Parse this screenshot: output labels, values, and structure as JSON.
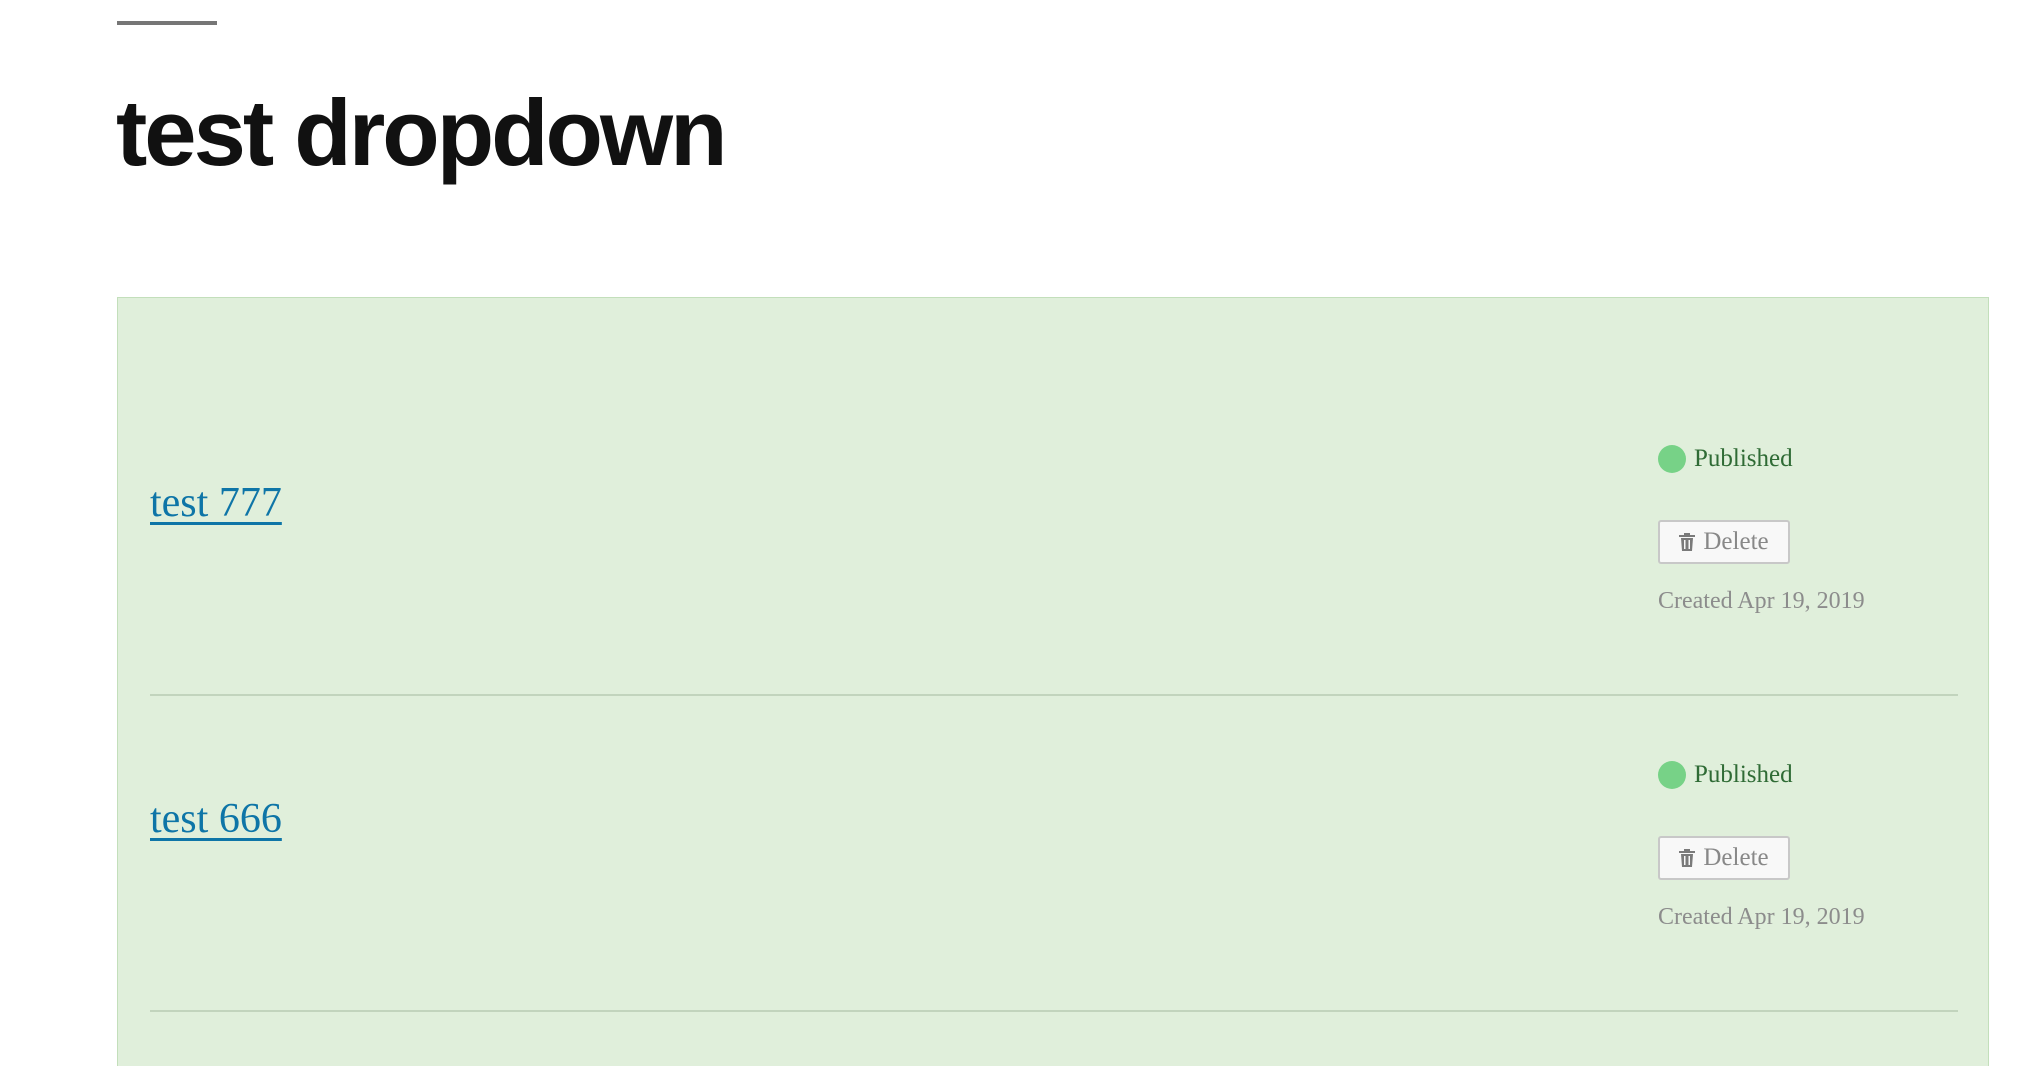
{
  "page": {
    "title": "test dropdown"
  },
  "responses": [
    {
      "title": "test 777",
      "status": "Published",
      "delete_label": "Delete",
      "created": "Created Apr 19, 2019"
    },
    {
      "title": "test 666",
      "status": "Published",
      "delete_label": "Delete",
      "created": "Created Apr 19, 2019"
    }
  ],
  "icons": {
    "status": "status-dot-icon",
    "delete": "trash-icon"
  },
  "colors": {
    "panel_background": "#e0efdb",
    "link": "#0e75a7",
    "status_dot": "#77d287",
    "status_text": "#2f6b35",
    "title": "#111111"
  }
}
